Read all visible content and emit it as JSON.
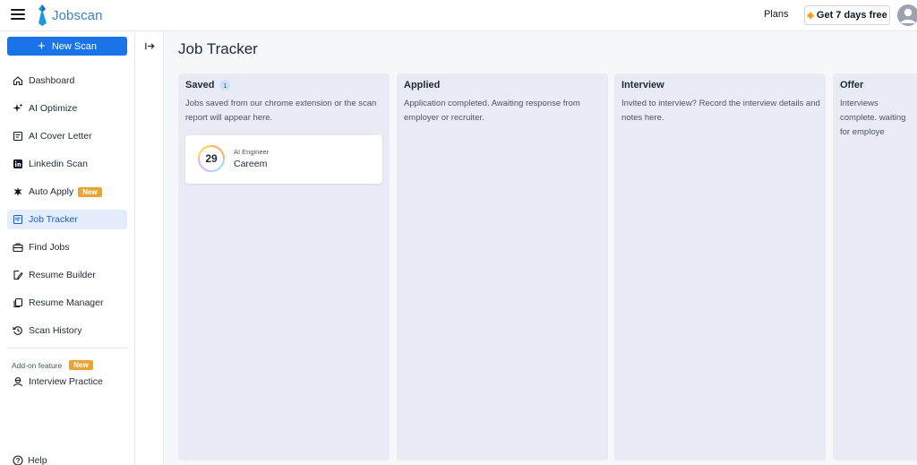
{
  "app": {
    "logo_text": "Jobscan",
    "plans_label": "Plans",
    "trial_label": "Get 7 days free",
    "brand_color": "#1a73e8"
  },
  "sidebar": {
    "new_scan_label": "New Scan",
    "items": [
      {
        "label": "Dashboard",
        "icon": "home-icon"
      },
      {
        "label": "AI Optimize",
        "icon": "sparkle-icon"
      },
      {
        "label": "AI Cover Letter",
        "icon": "letter-icon"
      },
      {
        "label": "Linkedin Scan",
        "icon": "linkedin-icon"
      },
      {
        "label": "Auto Apply",
        "icon": "auto-apply-icon",
        "badge": "New"
      },
      {
        "label": "Job Tracker",
        "icon": "tracker-icon",
        "active": true
      },
      {
        "label": "Find Jobs",
        "icon": "briefcase-icon"
      },
      {
        "label": "Resume Builder",
        "icon": "edit-document-icon"
      },
      {
        "label": "Resume Manager",
        "icon": "copy-icon"
      },
      {
        "label": "Scan History",
        "icon": "history-icon"
      }
    ],
    "addon_label": "Add-on feature",
    "addon_badge": "New",
    "interview_label": "Interview Practice",
    "help_label": "Help"
  },
  "main": {
    "title": "Job Tracker",
    "columns": [
      {
        "title": "Saved",
        "count": "1",
        "description": "Jobs saved from our chrome extension or the scan report will appear here."
      },
      {
        "title": "Applied",
        "description": "Application completed. Awaiting response from employer or recruiter."
      },
      {
        "title": "Interview",
        "description": "Invited to interview? Record the interview details and notes here."
      },
      {
        "title": "Offer",
        "description": "Interviews complete. waiting for employe"
      }
    ],
    "job_card": {
      "score": "29",
      "role": "AI Engineer",
      "company": "Careem"
    }
  }
}
